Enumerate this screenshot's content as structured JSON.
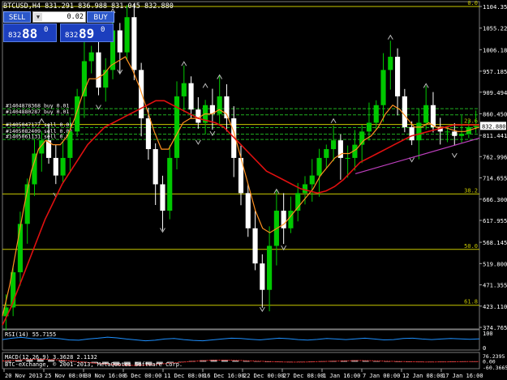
{
  "window": {
    "symbol_header": "BTCUSD,H4  831.291 836.988 831.045 832.880"
  },
  "trade_panel": {
    "sell_label": "SELL",
    "buy_label": "BUY",
    "lot_value": "0.02",
    "sell_prefix": "832",
    "sell_big": "88",
    "sell_sup": "0",
    "buy_prefix": "832",
    "buy_big": "89",
    "buy_sup": "0"
  },
  "colors": {
    "background": "#000000",
    "bull_candle": "#00c800",
    "bear_candle": "#ffffff",
    "ma_fast": "#ff9020",
    "ma_slow": "#e01010",
    "fib": "#c8c800",
    "trade_line": "#20b020",
    "trend_line": "#c040c0",
    "rsi": "#1e90ff",
    "macd_hist": "#b0b0b0",
    "macd_signal": "#ff3030"
  },
  "chart_data": [
    {
      "type": "candlestick",
      "symbol": "BTCUSD",
      "timeframe": "H4",
      "ohlc_header": {
        "open": 831.291,
        "high": 836.988,
        "low": 831.045,
        "close": 832.88
      },
      "current_price": "832.880",
      "y_ticks": [
        "1104.355",
        "1055.221",
        "1006.187",
        "957.185",
        "909.494",
        "860.450",
        "811.441",
        "762.996",
        "714.655",
        "666.300",
        "617.955",
        "568.145",
        "519.800",
        "471.355",
        "423.110",
        "374.765"
      ],
      "y_tick_values": [
        1104.355,
        1055.221,
        1006.187,
        957.185,
        909.494,
        860.45,
        811.441,
        762.996,
        714.655,
        666.3,
        617.955,
        568.145,
        519.8,
        471.355,
        423.11,
        374.765
      ],
      "ylim": [
        374.765,
        1104.355
      ],
      "x_ticks": [
        "20 Nov 2013",
        "25 Nov 08:00",
        "30 Nov 16:00",
        "6 Dec 00:00",
        "11 Dec 08:00",
        "16 Dec 16:00",
        "22 Dec 00:00",
        "27 Dec 08:00",
        "1 Jan 16:00",
        "7 Jan 00:00",
        "12 Jan 08:00",
        "17 Jan 16:00"
      ],
      "fib_levels": [
        {
          "label": "0.0",
          "price": 1104.355
        },
        {
          "label": "23.6",
          "price": 836
        },
        {
          "label": "38.2",
          "price": 678
        },
        {
          "label": "50.0",
          "price": 552
        },
        {
          "label": "61.8",
          "price": 425
        }
      ],
      "trade_lines": [
        {
          "label": "#1404878368 buy 0.01",
          "price": 872
        },
        {
          "label": "#1404880287 buy 0.01",
          "price": 858
        },
        {
          "label": "#1405047177 sell 0.01",
          "price": 829
        },
        {
          "label": "#1405082409 sell 0.02",
          "price": 814
        },
        {
          "label": "#1405061131 sell 0.02",
          "price": 802
        }
      ],
      "close_series": [
        420,
        500,
        610,
        700,
        770,
        800,
        760,
        720,
        760,
        820,
        900,
        980,
        1000,
        920,
        960,
        1050,
        1000,
        1080,
        960,
        850,
        780,
        700,
        640,
        760,
        900,
        930,
        870,
        840,
        880,
        860,
        900,
        850,
        760,
        680,
        600,
        520,
        460,
        560,
        640,
        600,
        640,
        680,
        700,
        720,
        760,
        780,
        800,
        760,
        760,
        790,
        820,
        840,
        880,
        960,
        990,
        900,
        830,
        800,
        840,
        880,
        830,
        820,
        820,
        810,
        815,
        830,
        832.88
      ],
      "ma_fast_series": [
        400,
        470,
        560,
        650,
        730,
        780,
        800,
        790,
        790,
        810,
        850,
        900,
        940,
        940,
        950,
        970,
        980,
        990,
        960,
        920,
        870,
        820,
        780,
        780,
        810,
        840,
        850,
        850,
        860,
        860,
        870,
        860,
        820,
        760,
        700,
        640,
        600,
        590,
        600,
        610,
        630,
        650,
        670,
        690,
        720,
        740,
        760,
        770,
        770,
        780,
        800,
        810,
        830,
        860,
        880,
        870,
        850,
        830,
        830,
        840,
        830,
        830,
        825,
        820,
        820,
        825,
        830
      ],
      "ma_slow_series": [
        380,
        420,
        470,
        520,
        570,
        620,
        660,
        700,
        730,
        760,
        790,
        810,
        830,
        840,
        850,
        860,
        870,
        880,
        890,
        890,
        880,
        870,
        860,
        850,
        845,
        840,
        830,
        810,
        790,
        770,
        750,
        730,
        720,
        710,
        700,
        690,
        685,
        680,
        685,
        695,
        710,
        730,
        750,
        760,
        770,
        780,
        790,
        800,
        810,
        815,
        820,
        825,
        830,
        835,
        835,
        835,
        835
      ],
      "trend_line_points": [
        [
          0.74,
          724
        ],
        [
          1.0,
          805
        ]
      ]
    },
    {
      "type": "line",
      "name": "RSI(14) 55.7155",
      "y_ticks": [
        "100",
        "0"
      ],
      "ylim": [
        0,
        100
      ],
      "values": [
        52,
        60,
        65,
        58,
        55,
        62,
        57,
        50,
        48,
        55,
        60,
        66,
        62,
        55,
        50,
        45,
        48,
        55,
        58,
        52,
        47,
        45,
        50,
        55,
        60,
        58,
        54,
        50,
        55,
        60,
        57,
        52,
        49,
        53,
        58,
        55,
        52,
        56,
        60,
        55,
        50,
        52,
        58,
        60,
        55,
        52,
        55,
        58,
        56,
        54,
        55.7155
      ]
    },
    {
      "type": "bar",
      "name": "MACD(12,26,9) 3.3628 2.1132",
      "y_ticks": [
        "76.2395",
        "0.00",
        "-60.3665"
      ],
      "ylim": [
        -60.3665,
        76.2395
      ],
      "values": [
        10,
        18,
        25,
        30,
        22,
        12,
        5,
        -5,
        -15,
        -25,
        -35,
        -40,
        -38,
        -30,
        -20,
        -10,
        0,
        8,
        15,
        20,
        18,
        12,
        8,
        4,
        0,
        -3,
        -5,
        -2,
        2,
        5,
        8,
        12,
        15,
        10,
        6,
        3,
        1,
        -1,
        -3,
        -2,
        0,
        2,
        4,
        3.3628
      ],
      "signal": [
        8,
        14,
        20,
        25,
        24,
        18,
        10,
        0,
        -10,
        -20,
        -28,
        -34,
        -36,
        -32,
        -25,
        -15,
        -6,
        3,
        10,
        15,
        16,
        14,
        10,
        6,
        2,
        -1,
        -3,
        -3,
        0,
        3,
        6,
        9,
        12,
        11,
        8,
        5,
        2,
        0,
        -2,
        -2,
        -1,
        1,
        2,
        2.1132
      ]
    }
  ],
  "copyright": "BTC-eXchange, © 2001-2013, MetaQuotes Software Corp."
}
